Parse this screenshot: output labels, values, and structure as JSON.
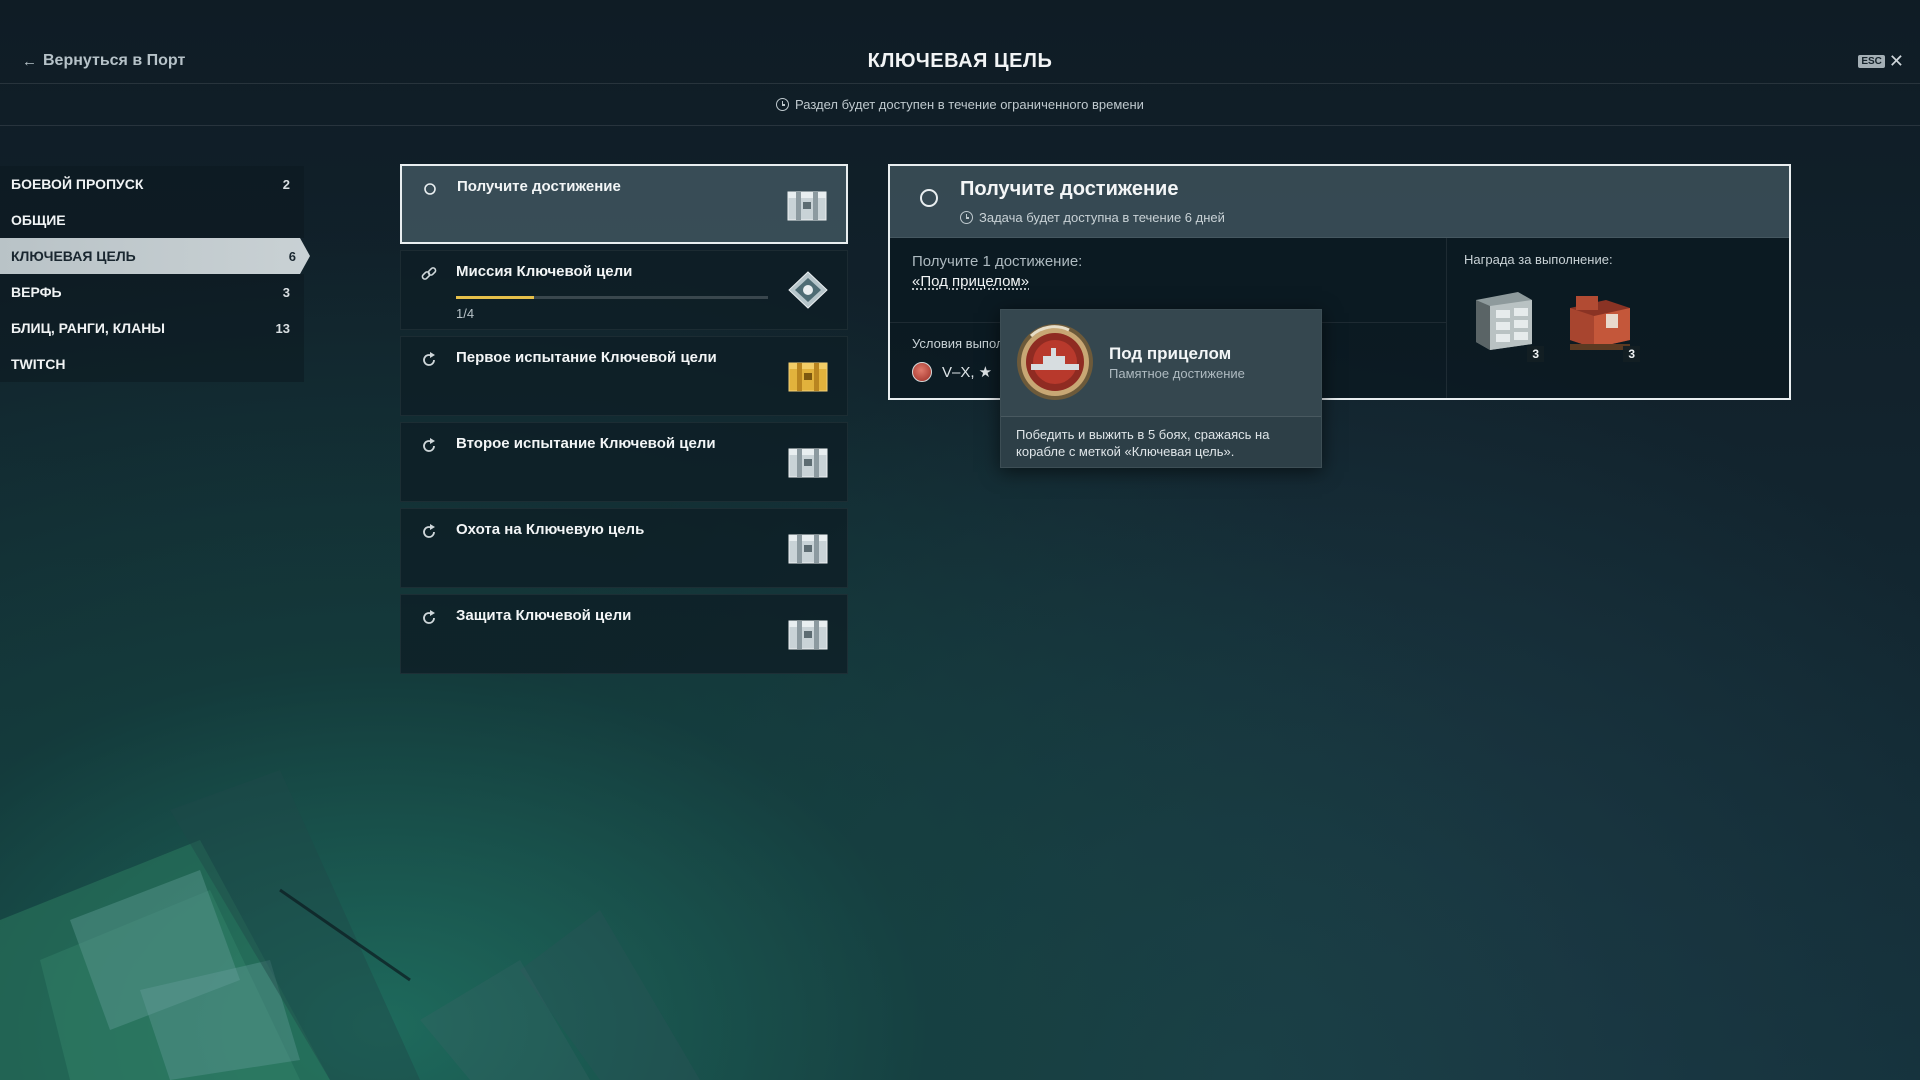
{
  "header": {
    "back_label": "Вернуться в Порт",
    "title": "КЛЮЧЕВАЯ ЦЕЛЬ",
    "esc_label": "ESC",
    "close_glyph": "✕",
    "back_arrow": "←"
  },
  "time_notice": "Раздел будет доступен в течение ограниченного времени",
  "sidebar": {
    "items": [
      {
        "label": "БОЕВОЙ ПРОПУСК",
        "count": "2",
        "active": false
      },
      {
        "label": "ОБЩИЕ",
        "count": "",
        "active": false
      },
      {
        "label": "КЛЮЧЕВАЯ ЦЕЛЬ",
        "count": "6",
        "active": true
      },
      {
        "label": "ВЕРФЬ",
        "count": "3",
        "active": false
      },
      {
        "label": "БЛИЦ, РАНГИ, КЛАНЫ",
        "count": "13",
        "active": false
      },
      {
        "label": "TWITCH",
        "count": "",
        "active": false
      }
    ]
  },
  "missions": [
    {
      "title": "Получите достижение",
      "icon": "circle-icon",
      "reward": "silver-container",
      "selected": true
    },
    {
      "title": "Миссия Ключевой цели",
      "icon": "link-icon",
      "reward": "diamond-token",
      "progress_text": "1/4",
      "progress": 0.25
    },
    {
      "title": "Первое испытание Ключевой цели",
      "icon": "refresh-icon",
      "reward": "gold-container"
    },
    {
      "title": "Второе испытание Ключевой цели",
      "icon": "refresh-icon",
      "reward": "silver-container"
    },
    {
      "title": "Охота на Ключевую цель",
      "icon": "refresh-icon",
      "reward": "silver-container"
    },
    {
      "title": "Защита Ключевой цели",
      "icon": "refresh-icon",
      "reward": "silver-container"
    }
  ],
  "detail": {
    "title": "Получите достижение",
    "subtitle": "Задача будет доступна в течение 6 дней",
    "task_line1": "Получите 1 достижение:",
    "task_achievement": "«Под прицелом»",
    "conditions_label": "Условия выпол",
    "conditions_value": "V–X, ★",
    "reward_label": "Награда за выполнение:",
    "rewards": [
      {
        "name": "cabinet-crate",
        "qty": "3"
      },
      {
        "name": "red-supply-crate",
        "qty": "3"
      }
    ]
  },
  "tooltip": {
    "name": "Под прицелом",
    "type": "Памятное достижение",
    "description": "Победить и выжить в 5 боях, сражаясь на корабле с меткой «Ключевая цель»."
  },
  "colors": {
    "progress_fill": "#e6c04a",
    "active_tab": "#c9d1d4",
    "selected_border": "#e9eef0"
  }
}
